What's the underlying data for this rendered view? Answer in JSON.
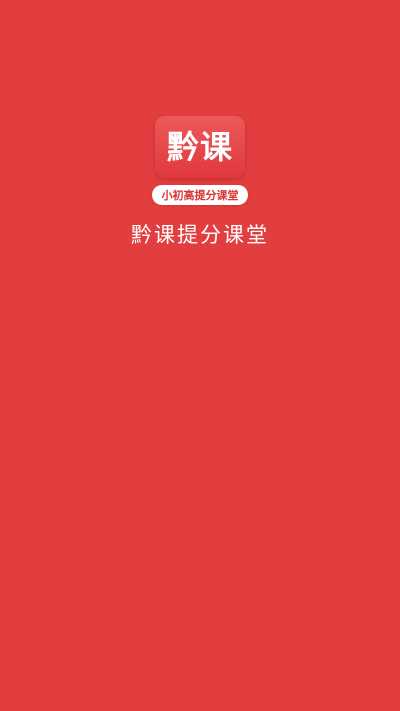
{
  "theme": {
    "background_color": "#e23e40",
    "logo_tile_color": "#e84a4c",
    "pill_color": "#ffffff",
    "pill_text_color": "#d83436",
    "text_color": "#ffffff"
  },
  "logo": {
    "text": "黔课",
    "subtitle": "小初高提分课堂"
  },
  "app_name": "黔课提分课堂"
}
